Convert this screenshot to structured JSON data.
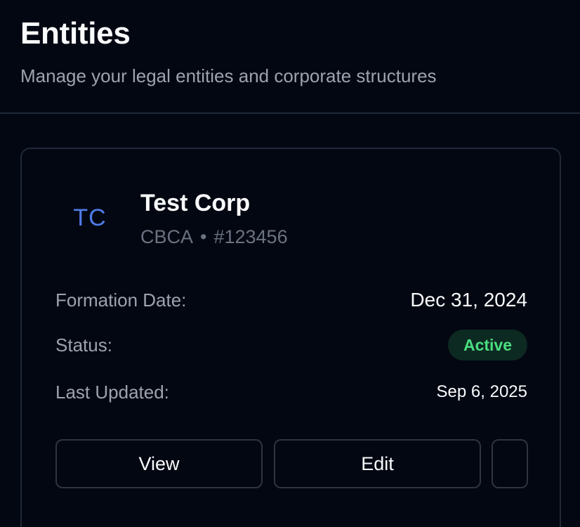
{
  "header": {
    "title": "Entities",
    "subtitle": "Manage your legal entities and corporate structures"
  },
  "entity": {
    "initials": "TC",
    "name": "Test Corp",
    "jurisdiction": "CBCA",
    "separator": "•",
    "number": "#123456",
    "fields": {
      "formation_label": "Formation Date:",
      "formation_value": "Dec 31, 2024",
      "status_label": "Status:",
      "status_value": "Active",
      "updated_label": "Last Updated:",
      "updated_value": "Sep 6, 2025"
    },
    "actions": {
      "view_label": "View",
      "edit_label": "Edit",
      "more_label": ""
    }
  },
  "colors": {
    "background": "#030712",
    "accent": "#4f7ce8",
    "status_active_text": "#4ade80",
    "status_active_bg": "#0d2a22",
    "border": "#1f2937"
  }
}
